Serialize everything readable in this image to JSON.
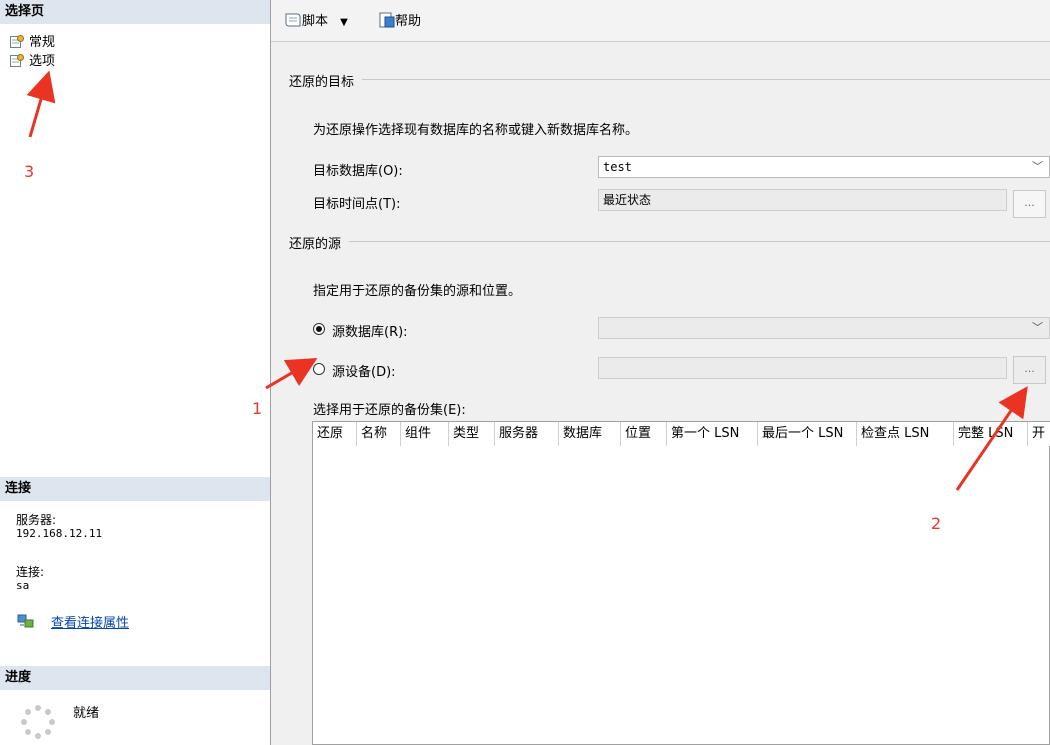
{
  "left_panel": {
    "select_page_header": "选择页",
    "pages": [
      {
        "label": "常规",
        "icon": "page-gear-icon"
      },
      {
        "label": "选项",
        "icon": "page-gear-icon"
      }
    ],
    "connection": {
      "header": "连接",
      "server_label": "服务器:",
      "server_value": "192.168.12.11",
      "connection_label": "连接:",
      "connection_value": "sa",
      "view_link": "查看连接属性"
    },
    "progress": {
      "header": "进度",
      "status": "就绪"
    }
  },
  "toolbar": {
    "script_label": "脚本",
    "help_label": "帮助"
  },
  "restore_target": {
    "title": "还原的目标",
    "description": "为还原操作选择现有数据库的名称或键入新数据库名称。",
    "target_db_label": "目标数据库(O):",
    "target_db_value": "test",
    "target_time_label": "目标时间点(T):",
    "target_time_value": "最近状态",
    "ellipsis": "..."
  },
  "restore_source": {
    "title": "还原的源",
    "description": "指定用于还原的备份集的源和位置。",
    "source_db_label": "源数据库(R):",
    "source_device_label": "源设备(D):",
    "selected": "source_db",
    "ellipsis": "...",
    "backup_set_label": "选择用于还原的备份集(E):"
  },
  "backup_grid": {
    "columns": [
      "还原",
      "名称",
      "组件",
      "类型",
      "服务器",
      "数据库",
      "位置",
      "第一个 LSN",
      "最后一个 LSN",
      "检查点 LSN",
      "完整 LSN",
      "开"
    ]
  },
  "annotations": {
    "labels": [
      "1",
      "2",
      "3"
    ],
    "color": "#e53935"
  }
}
